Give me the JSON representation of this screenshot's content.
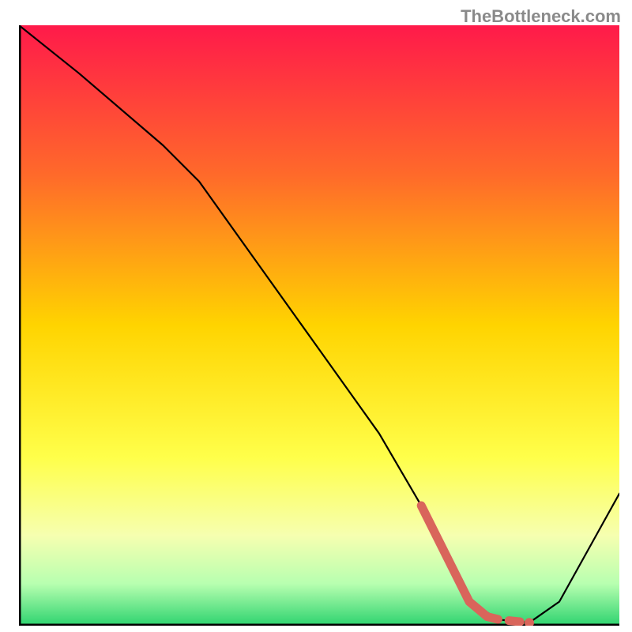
{
  "watermark": "TheBottleneck.com",
  "chart_data": {
    "type": "line",
    "title": "",
    "xlabel": "",
    "ylabel": "",
    "xlim": [
      0,
      100
    ],
    "ylim": [
      0,
      100
    ],
    "series": [
      {
        "name": "curve",
        "x": [
          0,
          10,
          24,
          30,
          40,
          50,
          60,
          67,
          72,
          75,
          80,
          85,
          90,
          100
        ],
        "y": [
          100,
          92,
          80,
          74,
          60,
          46,
          32,
          20,
          10,
          4,
          1,
          0.5,
          4,
          22
        ]
      },
      {
        "name": "highlight",
        "x": [
          67,
          72,
          75,
          78,
          80,
          83,
          85
        ],
        "y": [
          20,
          10,
          4,
          1.5,
          1,
          0.7,
          0.5
        ]
      }
    ],
    "gradient_stops": [
      {
        "offset": 0,
        "color": "#ff1a4a"
      },
      {
        "offset": 25,
        "color": "#ff6a2a"
      },
      {
        "offset": 50,
        "color": "#ffd400"
      },
      {
        "offset": 72,
        "color": "#ffff4a"
      },
      {
        "offset": 85,
        "color": "#f6ffb0"
      },
      {
        "offset": 93,
        "color": "#b8ffb0"
      },
      {
        "offset": 100,
        "color": "#2dd36f"
      }
    ]
  }
}
